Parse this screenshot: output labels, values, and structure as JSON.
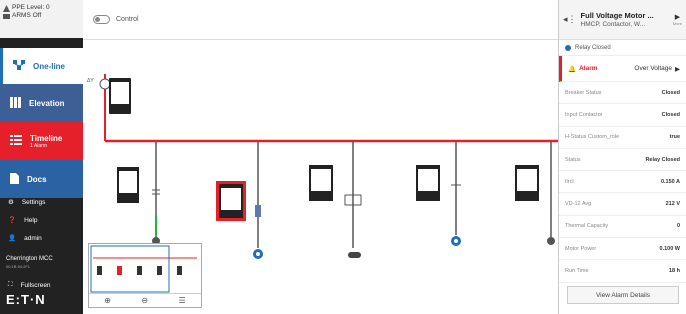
{
  "ppe": {
    "level": "PPE Level: 0",
    "arms": "ARMS Off"
  },
  "nav": {
    "oneline": "One-line",
    "elevation": "Elevation",
    "timeline": "Timeline",
    "timeline_sub": "1 Alarm",
    "docs": "Docs",
    "settings": "Settings",
    "help": "Help",
    "admin": "admin",
    "site": "Cherrington MCC",
    "site_sub": "00:1B:54:2F1",
    "fullscreen": "Fullscreen",
    "brand": "E:T·N"
  },
  "topbar": {
    "control_label": "Control"
  },
  "panel": {
    "title": "Full Voltage Motor ...",
    "subtitle": "HMCP, Contactor, W...",
    "more": "More",
    "relay": "Relay Closed",
    "alarm_label": "Alarm",
    "alarm_value": "Over Voltage",
    "props": [
      {
        "k": "Breaker Status",
        "v": "Closed"
      },
      {
        "k": "Input Contactor",
        "v": "Closed"
      },
      {
        "k": "H-Status Custom_role",
        "v": "true"
      },
      {
        "k": "Status",
        "v": "Relay Closed"
      },
      {
        "k": "Ilrcl",
        "v": "0.150 A"
      },
      {
        "k": "VD-12 Avg",
        "v": "212 V"
      },
      {
        "k": "Thermal Capacity",
        "v": "0"
      },
      {
        "k": "Motor Power",
        "v": "0.100 W"
      },
      {
        "k": "Run Time",
        "v": "18 h"
      }
    ],
    "view_button": "View Alarm Details"
  },
  "colors": {
    "accent": "#1f6fb6",
    "alarm": "#e5202a",
    "bus": "#e5202a",
    "sidebar": "#222222"
  }
}
